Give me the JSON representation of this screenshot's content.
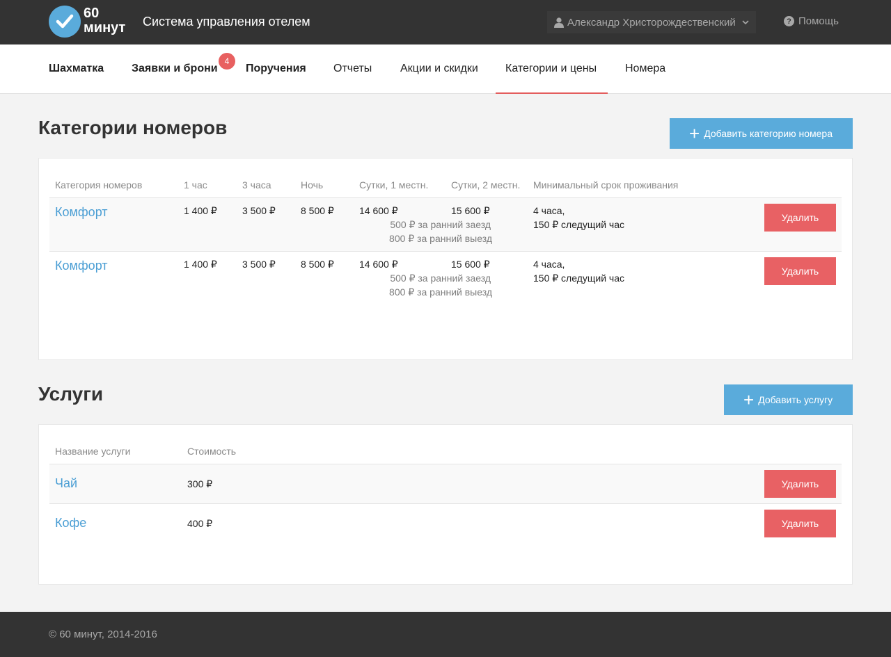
{
  "header": {
    "logo_line1": "60",
    "logo_line2": "минут",
    "app_title": "Система управления отелем",
    "user_name": "Александр Христорождественский",
    "help_label": "Помощь",
    "help_glyph": "?"
  },
  "nav": {
    "items": [
      {
        "label": "Шахматка"
      },
      {
        "label": "Заявки и брони",
        "badge": "4"
      },
      {
        "label": "Поручения"
      },
      {
        "label": "Отчеты"
      },
      {
        "label": "Акции и скидки"
      },
      {
        "label": "Категории и цены",
        "active": true
      },
      {
        "label": "Номера"
      }
    ]
  },
  "categories": {
    "title": "Категории номеров",
    "add_button": "Добавить категорию номера",
    "columns": [
      "Категория номеров",
      "1 час",
      "3 часа",
      "Ночь",
      "Сутки, 1 местн.",
      "Сутки, 2 местн.",
      "Минимальный срок проживания"
    ],
    "rows": [
      {
        "name": "Комфорт",
        "hour1": "1 400 ₽",
        "hour3": "3 500 ₽",
        "night": "8 500 ₽",
        "day1": "14 600 ₽",
        "day2": "15 600 ₽",
        "early_checkin": "500 ₽ за ранний заезд",
        "early_checkout": "800 ₽ за ранний выезд",
        "min_stay": "4 часа,",
        "next_hour": "150 ₽ следущий час",
        "delete_label": "Удалить"
      },
      {
        "name": "Комфорт",
        "hour1": "1 400 ₽",
        "hour3": "3 500 ₽",
        "night": "8 500 ₽",
        "day1": "14 600 ₽",
        "day2": "15 600 ₽",
        "early_checkin": "500 ₽ за ранний заезд",
        "early_checkout": "800 ₽ за ранний выезд",
        "min_stay": "4 часа,",
        "next_hour": "150 ₽ следущий час",
        "delete_label": "Удалить"
      }
    ]
  },
  "services": {
    "title": "Услуги",
    "add_button": "Добавить услугу",
    "columns": [
      "Название услуги",
      "Стоимость"
    ],
    "rows": [
      {
        "name": "Чай",
        "price": "300 ₽",
        "delete_label": "Удалить"
      },
      {
        "name": "Кофе",
        "price": "400 ₽",
        "delete_label": "Удалить"
      }
    ]
  },
  "footer": {
    "copyright": "© 60 минут, 2014-2016"
  },
  "colors": {
    "header_bg": "#333333",
    "accent_blue": "#5aabdb",
    "link_blue": "#4a9ed4",
    "danger_red": "#e86164",
    "active_underline": "#e35d5d"
  }
}
